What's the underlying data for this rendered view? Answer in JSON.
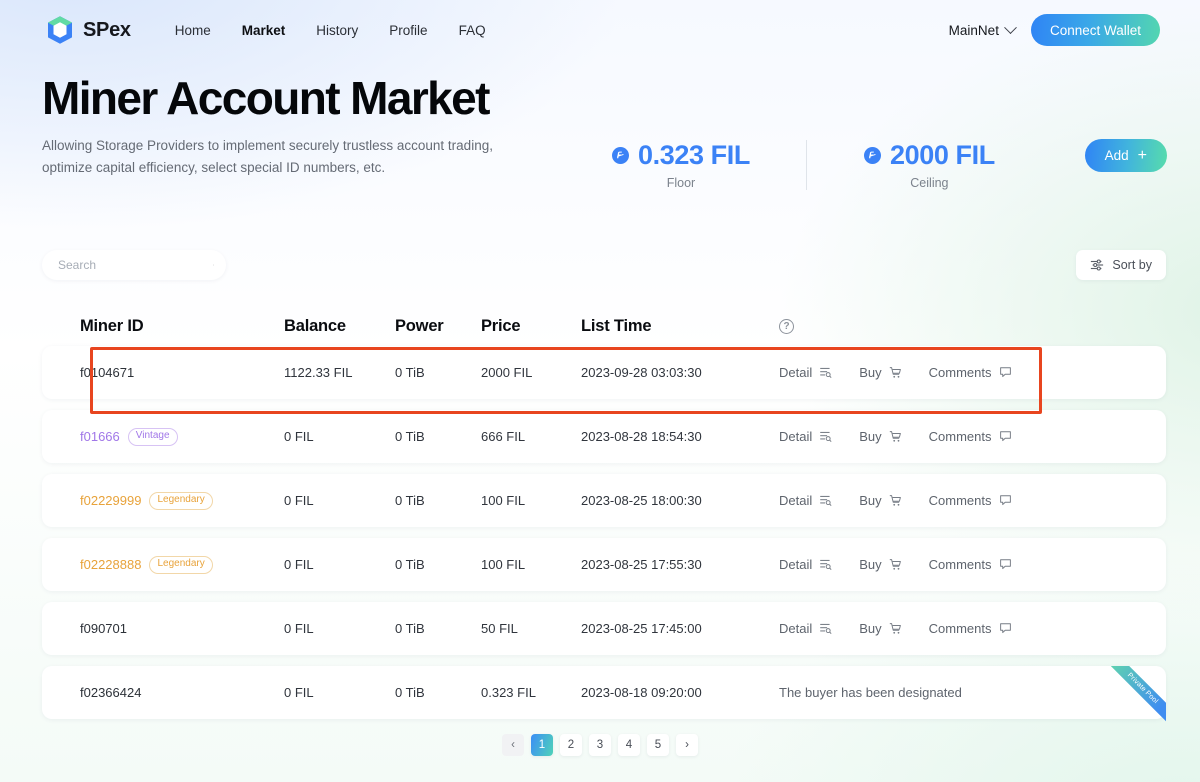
{
  "header": {
    "brand": "SPex",
    "nav": [
      {
        "label": "Home",
        "active": false
      },
      {
        "label": "Market",
        "active": true
      },
      {
        "label": "History",
        "active": false
      },
      {
        "label": "Profile",
        "active": false
      },
      {
        "label": "FAQ",
        "active": false
      }
    ],
    "network": "MainNet",
    "connect_wallet": "Connect Wallet"
  },
  "hero": {
    "title": "Miner Account Market",
    "subtitle": "Allowing Storage Providers to implement securely trustless account trading, optimize capital efficiency, select special ID numbers, etc.",
    "add_button": "Add",
    "stats": [
      {
        "value": "0.323 FIL",
        "label": "Floor"
      },
      {
        "value": "2000 FIL",
        "label": "Ceiling"
      }
    ]
  },
  "toolbar": {
    "search_placeholder": "Search",
    "search_value": "",
    "sort_label": "Sort by"
  },
  "table": {
    "columns": [
      "Miner ID",
      "Balance",
      "Power",
      "Price",
      "List Time"
    ],
    "help_icon": "?",
    "actions": {
      "detail": "Detail",
      "buy": "Buy",
      "comments": "Comments"
    },
    "rows": [
      {
        "miner_id": "f0104671",
        "badge": "",
        "badge_kind": "",
        "balance": "1122.33 FIL",
        "power": "0 TiB",
        "price": "2000 FIL",
        "list_time": "2023-09-28 03:03:30",
        "status": "",
        "ribbon": "",
        "highlighted": true
      },
      {
        "miner_id": "f01666",
        "badge": "Vintage",
        "badge_kind": "vintage",
        "balance": "0 FIL",
        "power": "0 TiB",
        "price": "666 FIL",
        "list_time": "2023-08-28 18:54:30",
        "status": "",
        "ribbon": "",
        "highlighted": false
      },
      {
        "miner_id": "f02229999",
        "badge": "Legendary",
        "badge_kind": "legendary",
        "balance": "0 FIL",
        "power": "0 TiB",
        "price": "100 FIL",
        "list_time": "2023-08-25 18:00:30",
        "status": "",
        "ribbon": "",
        "highlighted": false
      },
      {
        "miner_id": "f02228888",
        "badge": "Legendary",
        "badge_kind": "legendary",
        "balance": "0 FIL",
        "power": "0 TiB",
        "price": "100 FIL",
        "list_time": "2023-08-25 17:55:30",
        "status": "",
        "ribbon": "",
        "highlighted": false
      },
      {
        "miner_id": "f090701",
        "badge": "",
        "badge_kind": "",
        "balance": "0 FIL",
        "power": "0 TiB",
        "price": "50 FIL",
        "list_time": "2023-08-25 17:45:00",
        "status": "",
        "ribbon": "",
        "highlighted": false
      },
      {
        "miner_id": "f02366424",
        "badge": "",
        "badge_kind": "",
        "balance": "0 FIL",
        "power": "0 TiB",
        "price": "0.323 FIL",
        "list_time": "2023-08-18 09:20:00",
        "status": "The buyer has been designated",
        "ribbon": "Private Pool",
        "highlighted": false
      }
    ]
  },
  "pagination": {
    "prev": "‹",
    "next": "›",
    "pages": [
      "1",
      "2",
      "3",
      "4",
      "5"
    ],
    "current": "1"
  },
  "colors": {
    "accent_blue": "#3b82f6",
    "accent_green": "#53d6b0",
    "vintage": "#a177e8",
    "legendary": "#e8a33b",
    "annotation": "#e8451f"
  }
}
